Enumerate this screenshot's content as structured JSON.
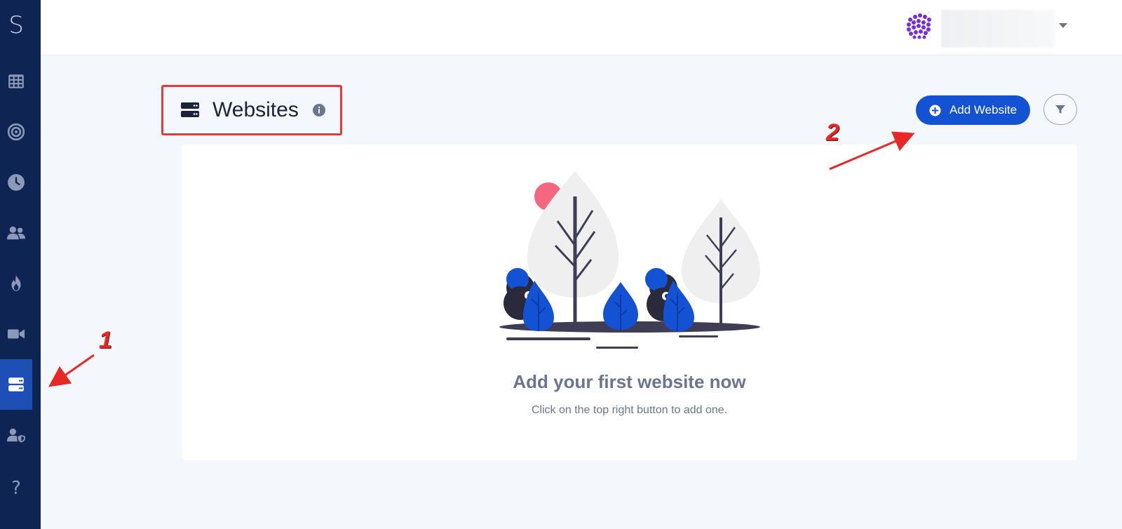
{
  "sidebar": {
    "logo": "S",
    "items": [
      {
        "name": "grid-icon"
      },
      {
        "name": "target-icon"
      },
      {
        "name": "clock-icon"
      },
      {
        "name": "users-icon"
      },
      {
        "name": "fire-icon"
      },
      {
        "name": "video-icon"
      },
      {
        "name": "server-icon",
        "active": true
      },
      {
        "name": "user-shield-icon"
      },
      {
        "name": "help-icon",
        "label": "?"
      }
    ]
  },
  "header": {
    "user_name": ""
  },
  "page": {
    "title": "Websites",
    "add_button_label": "Add Website"
  },
  "empty_state": {
    "title": "Add your first website now",
    "subtitle": "Click on the top right button to add one."
  },
  "annotations": {
    "one": "1",
    "two": "2"
  },
  "colors": {
    "sidebar_bg": "#0e2453",
    "sidebar_active": "#1d4fb5",
    "accent": "#1452d4",
    "annotation": "#e82727",
    "background": "#f4f7fc"
  }
}
